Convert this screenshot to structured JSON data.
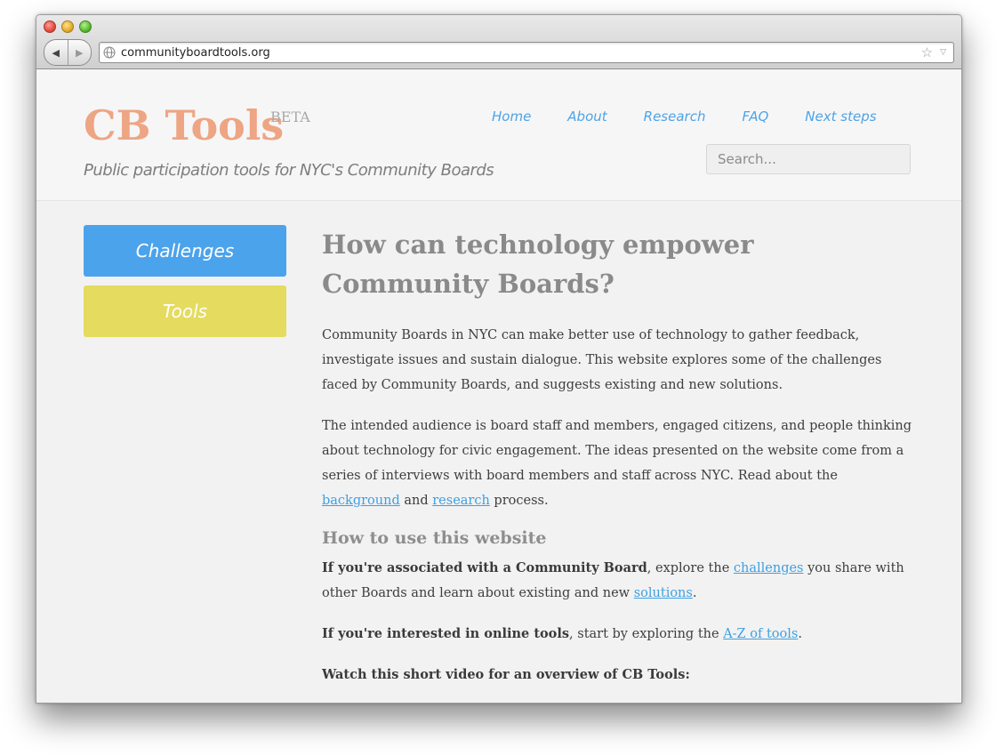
{
  "browser": {
    "url": "communityboardtools.org",
    "back_label": "◀",
    "forward_label": "▶",
    "star_label": "☆",
    "dropdown_label": "▽"
  },
  "header": {
    "brand": "CB Tools",
    "beta": "BETA",
    "tagline": "Public participation tools for NYC's Community Boards",
    "nav": [
      "Home",
      "About",
      "Research",
      "FAQ",
      "Next steps"
    ],
    "search_placeholder": "Search..."
  },
  "sidebar": {
    "buttons": [
      {
        "label": "Challenges",
        "color": "#4ba3ec"
      },
      {
        "label": "Tools",
        "color": "#e5db5f"
      }
    ]
  },
  "main": {
    "title": "How can technology empower Community Boards?",
    "intro": "Community Boards in NYC can make better use of technology to gather feedback, investigate issues and sustain dialogue. This website explores some of the challenges faced by Community Boards, and suggests existing and new solutions.",
    "audience_text": "The intended audience is board staff and members, engaged citizens, and people thinking about technology for civic engagement. The ideas presented on the website come from a series of interviews with board members and staff across NYC. Read about the",
    "background_link": "background",
    "and_word": "and",
    "research_link": "research",
    "process_text": "process.",
    "howto_heading": "How to use this website",
    "assoc_bold": "If you're associated with a Community Board",
    "assoc_text1": ", explore the",
    "challenges_link": "challenges",
    "assoc_text2": "you share with other Boards and learn about existing and new",
    "solutions_link": "solutions",
    "period": ".",
    "online_bold": "If you're interested in online tools",
    "online_text": ", start by exploring the",
    "az_link": "A-Z of tools",
    "video_bold": "Watch this short video for an overview of CB Tools:"
  }
}
